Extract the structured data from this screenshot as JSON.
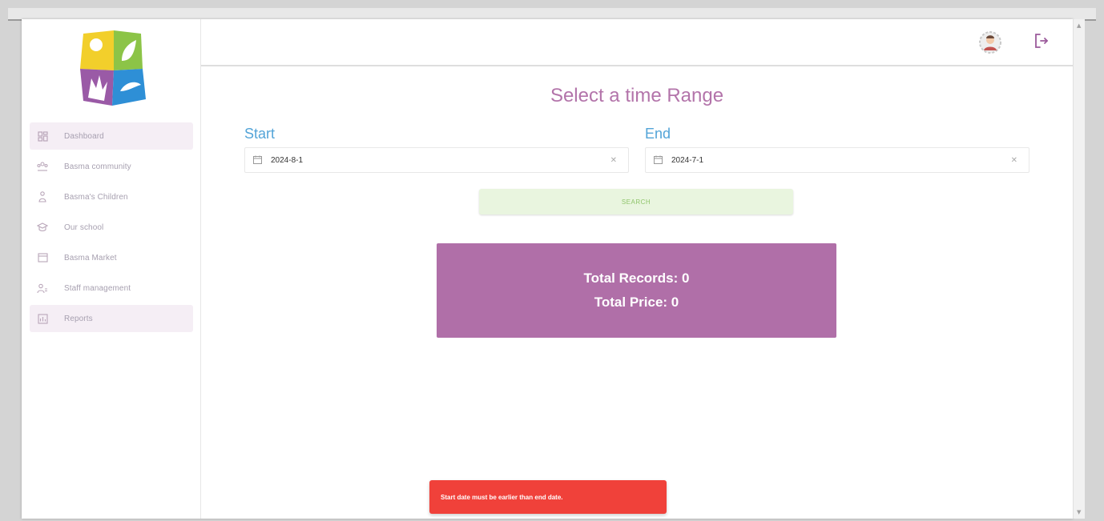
{
  "sidebar": {
    "items": [
      {
        "label": "Dashboard",
        "icon": "dashboard-icon",
        "active": true
      },
      {
        "label": "Basma community",
        "icon": "community-icon",
        "active": false
      },
      {
        "label": "Basma's Children",
        "icon": "child-icon",
        "active": false
      },
      {
        "label": "Our school",
        "icon": "school-icon",
        "active": false
      },
      {
        "label": "Basma Market",
        "icon": "market-icon",
        "active": false
      },
      {
        "label": "Staff management",
        "icon": "staff-icon",
        "active": false
      },
      {
        "label": "Reports",
        "icon": "reports-icon",
        "active": true
      }
    ]
  },
  "header": {
    "avatar_icon": "avatar-icon",
    "logout_icon": "logout-icon"
  },
  "main": {
    "title": "Select a time Range",
    "start": {
      "label": "Start",
      "value": "2024-8-1"
    },
    "end": {
      "label": "End",
      "value": "2024-7-1"
    },
    "search_label": "SEARCH",
    "summary": {
      "records": "Total Records: 0",
      "price": "Total Price: 0"
    }
  },
  "toast": {
    "message": "Start date must be earlier than end date."
  },
  "colors": {
    "accent": "#b06fa8",
    "title": "#b374aa",
    "label": "#53a4d8",
    "search_bg": "#e9f5df",
    "toast": "#f0413a"
  }
}
